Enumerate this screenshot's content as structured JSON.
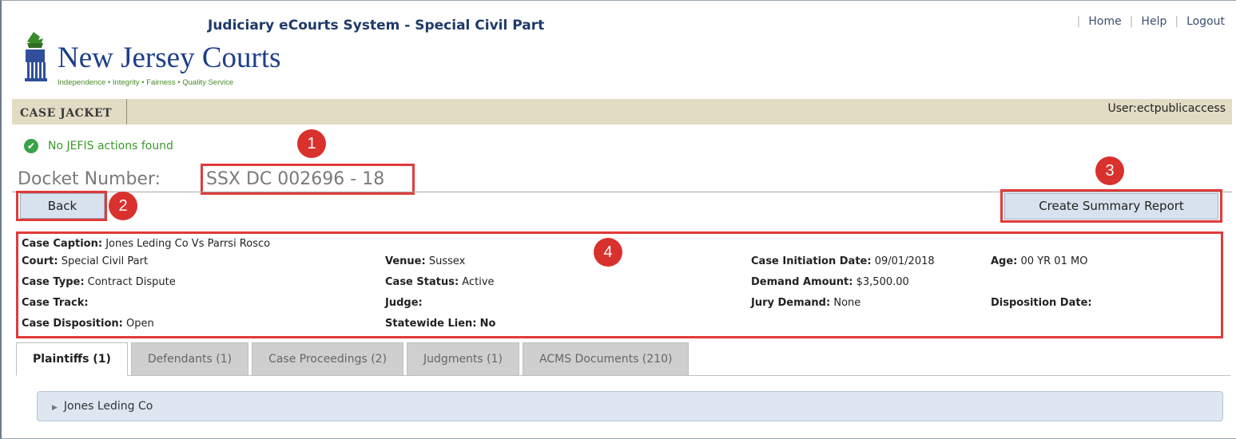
{
  "header": {
    "system_title": "Judiciary eCourts System - Special Civil Part",
    "links": {
      "home": "Home",
      "help": "Help",
      "logout": "Logout"
    },
    "brand_name": "New Jersey Courts",
    "tagline": "Independence • Integrity • Fairness • Quality Service"
  },
  "nav": {
    "tab": "CASE JACKET",
    "user": "User:ectpublicaccess"
  },
  "message": {
    "text": "No JEFIS actions found"
  },
  "docket": {
    "label": "Docket Number:",
    "number": "SSX DC 002696 - 18"
  },
  "buttons": {
    "back": "Back",
    "summary": "Create Summary Report"
  },
  "annotations": [
    "1",
    "2",
    "3",
    "4"
  ],
  "case": {
    "caption": {
      "label": "Case Caption:",
      "value": "Jones Leding Co Vs Parrsi Rosco"
    },
    "court": {
      "label": "Court:",
      "value": "Special Civil Part"
    },
    "venue": {
      "label": "Venue:",
      "value": "Sussex"
    },
    "initiation_date": {
      "label": "Case Initiation Date:",
      "value": "09/01/2018"
    },
    "age": {
      "label": "Age:",
      "value": "00 YR 01 MO"
    },
    "type": {
      "label": "Case Type:",
      "value": "Contract Dispute"
    },
    "status": {
      "label": "Case Status:",
      "value": "Active"
    },
    "demand_amount": {
      "label": "Demand Amount:",
      "value": "$3,500.00"
    },
    "track": {
      "label": "Case Track:",
      "value": ""
    },
    "judge": {
      "label": "Judge:",
      "value": ""
    },
    "jury_demand": {
      "label": "Jury Demand:",
      "value": "None"
    },
    "disposition_date": {
      "label": "Disposition Date:",
      "value": ""
    },
    "disposition": {
      "label": "Case Disposition:",
      "value": "Open"
    },
    "statewide_lien": {
      "label": "Statewide Lien:",
      "value": "No"
    }
  },
  "tabs": [
    {
      "label": "Plaintiffs (1)"
    },
    {
      "label": "Defendants (1)"
    },
    {
      "label": "Case Proceedings (2)"
    },
    {
      "label": "Judgments (1)"
    },
    {
      "label": "ACMS Documents (210)"
    }
  ],
  "plaintiffs": [
    {
      "name": "Jones Leding Co"
    }
  ],
  "colors": {
    "highlight": "#e03a3a",
    "badge": "#d9312d",
    "brand": "#1d3f8a",
    "tagline": "#4a8a2a",
    "navbar": "#e2dcc4"
  }
}
